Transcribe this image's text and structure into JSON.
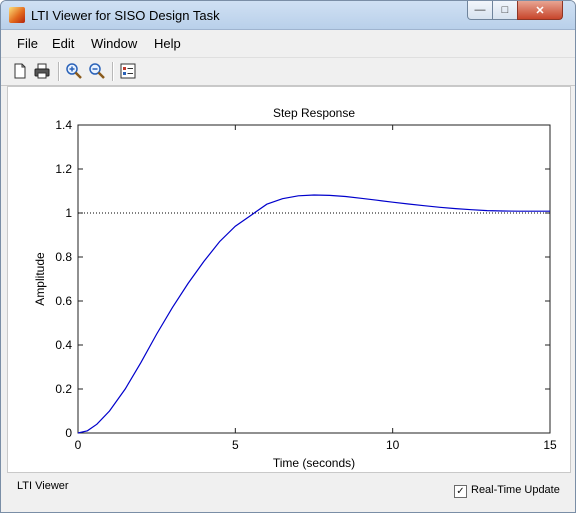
{
  "window": {
    "title": "LTI Viewer for SISO Design Task",
    "min_glyph": "—",
    "max_glyph": "□",
    "close_glyph": "✕"
  },
  "menu": [
    "File",
    "Edit",
    "Window",
    "Help"
  ],
  "toolbar": {
    "icons": [
      "new-file-icon",
      "print-icon",
      "zoom-in-icon",
      "zoom-out-icon",
      "plot-config-icon"
    ]
  },
  "status": {
    "text": "LTI Viewer",
    "realtime_label": "Real-Time Update",
    "realtime_checked": true,
    "check_glyph": "✓"
  },
  "chart_data": {
    "type": "line",
    "title": "Step Response",
    "xlabel": "Time (seconds)",
    "ylabel": "Amplitude",
    "xlim": [
      0,
      15
    ],
    "ylim": [
      0,
      1.4
    ],
    "xticks": [
      0,
      5,
      10,
      15
    ],
    "yticks": [
      0,
      0.2,
      0.4,
      0.6,
      0.8,
      1,
      1.2,
      1.4
    ],
    "grid": false,
    "reference_line": 1,
    "series": [
      {
        "color": "#0000cc",
        "x": [
          0,
          0.3,
          0.6,
          1,
          1.5,
          2,
          2.5,
          3,
          3.5,
          4,
          4.5,
          5,
          5.5,
          6,
          6.5,
          7,
          7.5,
          8,
          8.5,
          9,
          9.5,
          10,
          10.5,
          11,
          11.5,
          12,
          12.5,
          13,
          13.5,
          14,
          14.5,
          15
        ],
        "y": [
          0,
          0.01,
          0.04,
          0.1,
          0.2,
          0.32,
          0.45,
          0.57,
          0.68,
          0.78,
          0.87,
          0.94,
          0.99,
          1.04,
          1.065,
          1.078,
          1.082,
          1.08,
          1.075,
          1.067,
          1.058,
          1.049,
          1.041,
          1.033,
          1.026,
          1.02,
          1.015,
          1.011,
          1.009,
          1.008,
          1.008,
          1.008
        ]
      }
    ]
  }
}
